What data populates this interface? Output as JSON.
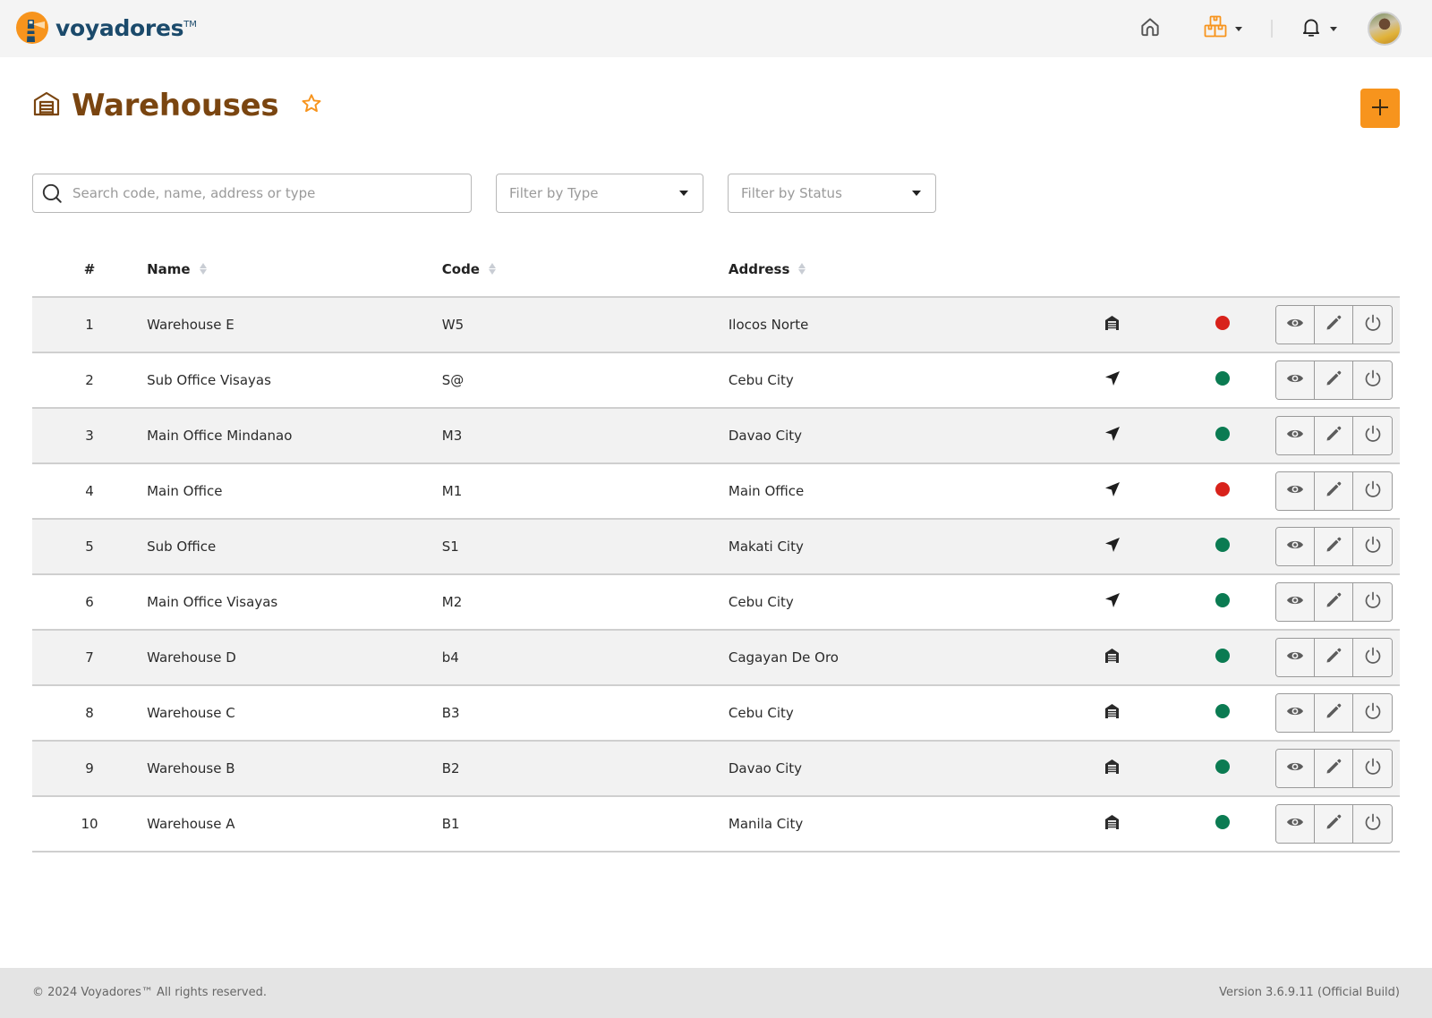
{
  "brand": {
    "name": "voyadores",
    "trademark": "TM",
    "accent": "#f7941d",
    "text_color": "#1b4a6b"
  },
  "nav": {
    "home_icon": "home-icon",
    "warehouse_menu_icon": "boxes-icon",
    "notifications_icon": "bell-icon",
    "avatar": "user-avatar"
  },
  "page": {
    "title": "Warehouses",
    "title_icon": "warehouse-icon",
    "favorite_icon": "star-outline-icon",
    "add_button_icon": "plus-icon",
    "title_color": "#7a4510"
  },
  "filters": {
    "search_placeholder": "Search code, name, address or type",
    "search_value": "",
    "type_placeholder": "Filter by Type",
    "status_placeholder": "Filter by Status"
  },
  "table": {
    "headers": {
      "num": "#",
      "name": "Name",
      "code": "Code",
      "address": "Address"
    },
    "status_colors": {
      "active": "#0b7b52",
      "inactive": "#d8221b"
    },
    "rows": [
      {
        "num": "1",
        "name": "Warehouse E",
        "code": "W5",
        "address": "Ilocos Norte",
        "type": "warehouse",
        "status": "inactive"
      },
      {
        "num": "2",
        "name": "Sub Office Visayas",
        "code": "S@",
        "address": "Cebu City",
        "type": "office",
        "status": "active"
      },
      {
        "num": "3",
        "name": "Main Office Mindanao",
        "code": "M3",
        "address": "Davao City",
        "type": "office",
        "status": "active"
      },
      {
        "num": "4",
        "name": "Main Office",
        "code": "M1",
        "address": "Main Office",
        "type": "office",
        "status": "inactive"
      },
      {
        "num": "5",
        "name": "Sub Office",
        "code": "S1",
        "address": "Makati City",
        "type": "office",
        "status": "active"
      },
      {
        "num": "6",
        "name": "Main Office Visayas",
        "code": "M2",
        "address": "Cebu City",
        "type": "office",
        "status": "active"
      },
      {
        "num": "7",
        "name": "Warehouse D",
        "code": "b4",
        "address": "Cagayan De Oro",
        "type": "warehouse",
        "status": "active"
      },
      {
        "num": "8",
        "name": "Warehouse C",
        "code": "B3",
        "address": "Cebu City",
        "type": "warehouse",
        "status": "active"
      },
      {
        "num": "9",
        "name": "Warehouse B",
        "code": "B2",
        "address": "Davao City",
        "type": "warehouse",
        "status": "active"
      },
      {
        "num": "10",
        "name": "Warehouse A",
        "code": "B1",
        "address": "Manila City",
        "type": "warehouse",
        "status": "active"
      }
    ],
    "row_actions": [
      "view",
      "edit",
      "toggle-power"
    ]
  },
  "footer": {
    "copyright": "© 2024 Voyadores™ All rights reserved.",
    "version": "Version 3.6.9.11 (Official Build)"
  }
}
